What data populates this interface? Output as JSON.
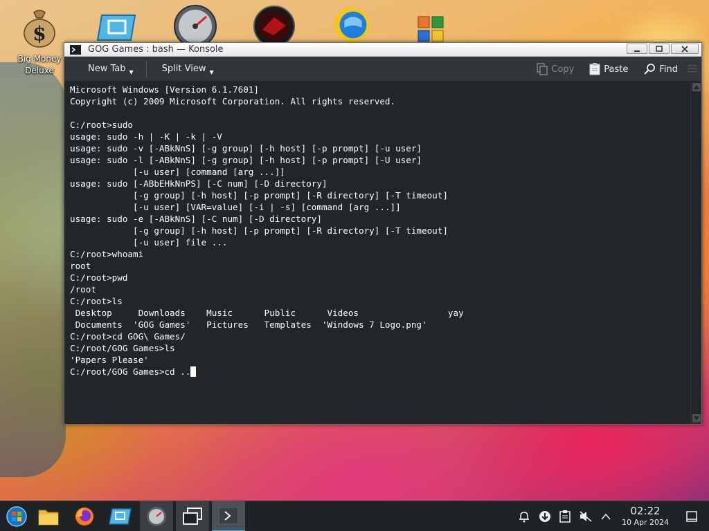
{
  "desktop": {
    "icons": [
      {
        "name": "money-bag-icon",
        "label": "Big Money Deluxe"
      },
      {
        "name": "display-icon",
        "label": ""
      },
      {
        "name": "gauge-icon",
        "label": ""
      },
      {
        "name": "red-game-icon",
        "label": ""
      },
      {
        "name": "windows-globe-icon",
        "label": ""
      },
      {
        "name": "office-icon",
        "label": ""
      }
    ]
  },
  "window": {
    "title": "GOG Games : bash — Konsole",
    "toolbar": {
      "new_tab": "New Tab",
      "split_view": "Split View",
      "copy": "Copy",
      "paste": "Paste",
      "find": "Find"
    },
    "terminal": {
      "lines": [
        "Microsoft Windows [Version 6.1.7601]",
        "Copyright (c) 2009 Microsoft Corporation. All rights reserved.",
        "",
        "C:/root>sudo",
        "usage: sudo -h | -K | -k | -V",
        "usage: sudo -v [-ABkNnS] [-g group] [-h host] [-p prompt] [-u user]",
        "usage: sudo -l [-ABkNnS] [-g group] [-h host] [-p prompt] [-U user]",
        "            [-u user] [command [arg ...]]",
        "usage: sudo [-ABbEHkNnPS] [-C num] [-D directory]",
        "            [-g group] [-h host] [-p prompt] [-R directory] [-T timeout]",
        "            [-u user] [VAR=value] [-i | -s] [command [arg ...]]",
        "usage: sudo -e [-ABkNnS] [-C num] [-D directory]",
        "            [-g group] [-h host] [-p prompt] [-R directory] [-T timeout]",
        "            [-u user] file ...",
        "C:/root>whoami",
        "root",
        "C:/root>pwd",
        "/root",
        "C:/root>ls",
        " Desktop     Downloads    Music      Public      Videos                 yay",
        " Documents  'GOG Games'   Pictures   Templates  'Windows 7 Logo.png'",
        "C:/root>cd GOG\\ Games/",
        "C:/root/GOG Games>ls",
        "'Papers Please'"
      ],
      "prompt_line": "C:/root/GOG Games>cd .."
    }
  },
  "taskbar": {
    "items": [
      {
        "name": "start-menu-icon"
      },
      {
        "name": "file-manager-icon"
      },
      {
        "name": "firefox-icon"
      },
      {
        "name": "display-icon"
      },
      {
        "name": "gauge-icon"
      },
      {
        "name": "task-switcher-icon"
      },
      {
        "name": "konsole-icon"
      }
    ],
    "tray": [
      {
        "name": "notifications-icon"
      },
      {
        "name": "updates-icon"
      },
      {
        "name": "clipboard-icon"
      },
      {
        "name": "volume-muted-icon"
      },
      {
        "name": "tray-expand-icon"
      }
    ],
    "clock_time": "02:22",
    "clock_date": "10 Apr 2024"
  }
}
